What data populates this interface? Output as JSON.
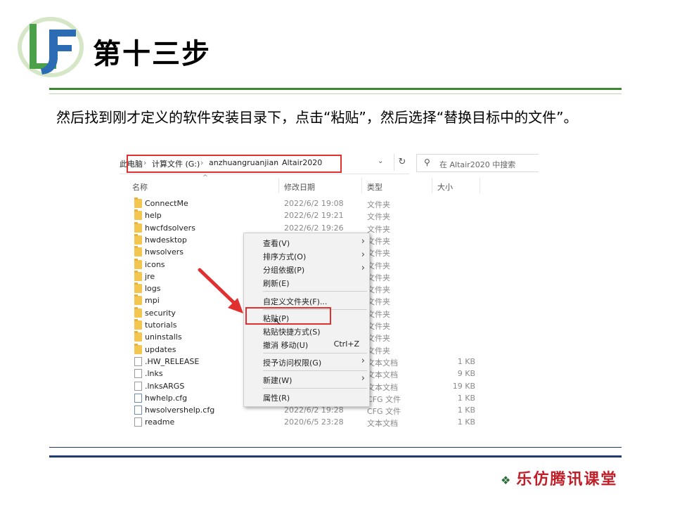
{
  "slide": {
    "title": "第十三步",
    "instruction": "然后找到刚才定义的软件安装目录下，点击“粘贴”，然后选择“替换目标中的文件”。",
    "footer": "乐仿腾讯课堂",
    "colors": {
      "green_rule": "#3a8a2e",
      "blue_rule": "#1f3b73",
      "highlight": "#e03030",
      "footer": "#c0202a"
    }
  },
  "explorer": {
    "breadcrumb": [
      "此电脑",
      "计算文件 (G:)",
      "anzhuangruanjian",
      "Altair2020"
    ],
    "search_placeholder": "在 Altair2020 中搜索",
    "columns": {
      "name": "名称",
      "date": "修改日期",
      "type": "类型",
      "size": "大小"
    },
    "rows": [
      {
        "name": "ConnectMe",
        "date": "2022/6/2 19:08",
        "type": "文件夹",
        "size": "",
        "icon": "folder-icon"
      },
      {
        "name": "help",
        "date": "2022/6/2 19:21",
        "type": "文件夹",
        "size": "",
        "icon": "folder-icon"
      },
      {
        "name": "hwcfdsolvers",
        "date": "2022/6/2 19:26",
        "type": "文件夹",
        "size": "",
        "icon": "folder-icon"
      },
      {
        "name": "hwdesktop",
        "date": "",
        "type": "文件夹",
        "size": "",
        "icon": "folder-icon"
      },
      {
        "name": "hwsolvers",
        "date": "",
        "type": "文件夹",
        "size": "",
        "icon": "folder-icon"
      },
      {
        "name": "icons",
        "date": "",
        "type": "文件夹",
        "size": "",
        "icon": "folder-icon"
      },
      {
        "name": "jre",
        "date": "",
        "type": "文件夹",
        "size": "",
        "icon": "folder-icon"
      },
      {
        "name": "logs",
        "date": "",
        "type": "文件夹",
        "size": "",
        "icon": "folder-icon"
      },
      {
        "name": "mpi",
        "date": "",
        "type": "文件夹",
        "size": "",
        "icon": "folder-icon"
      },
      {
        "name": "security",
        "date": "",
        "type": "文件夹",
        "size": "",
        "icon": "folder-icon"
      },
      {
        "name": "tutorials",
        "date": "",
        "type": "文件夹",
        "size": "",
        "icon": "folder-icon"
      },
      {
        "name": "uninstalls",
        "date": "",
        "type": "文件夹",
        "size": "",
        "icon": "folder-icon"
      },
      {
        "name": "updates",
        "date": "",
        "type": "文件夹",
        "size": "",
        "icon": "folder-icon"
      },
      {
        "name": ".HW_RELEASE",
        "date": "",
        "type": "文本文档",
        "size": "1 KB",
        "icon": "file-icon"
      },
      {
        "name": ".lnks",
        "date": "",
        "type": "文本文档",
        "size": "9 KB",
        "icon": "file-icon"
      },
      {
        "name": ".lnksARGS",
        "date": "",
        "type": "文本文档",
        "size": "19 KB",
        "icon": "file-icon"
      },
      {
        "name": "hwhelp.cfg",
        "date": "",
        "type": "CFG 文件",
        "size": "1 KB",
        "icon": "cfg-file-icon"
      },
      {
        "name": "hwsolvershelp.cfg",
        "date": "2022/6/2 19:28",
        "type": "CFG 文件",
        "size": "1 KB",
        "icon": "cfg-file-icon"
      },
      {
        "name": "readme",
        "date": "2020/6/5 23:28",
        "type": "文本文档",
        "size": "1 KB",
        "icon": "file-icon"
      }
    ]
  },
  "context_menu": {
    "items": [
      {
        "label": "查看(V)",
        "shortcut": "",
        "submenu": true
      },
      {
        "label": "排序方式(O)",
        "shortcut": "",
        "submenu": true
      },
      {
        "label": "分组依据(P)",
        "shortcut": "",
        "submenu": true
      },
      {
        "label": "刷新(E)",
        "shortcut": "",
        "submenu": false
      },
      {
        "label": "自定义文件夹(F)...",
        "shortcut": "",
        "submenu": false
      },
      {
        "label": "粘贴(P)",
        "shortcut": "",
        "submenu": false
      },
      {
        "label": "粘贴快捷方式(S)",
        "shortcut": "",
        "submenu": false
      },
      {
        "label": "撤消 移动(U)",
        "shortcut": "Ctrl+Z",
        "submenu": false
      },
      {
        "label": "授予访问权限(G)",
        "shortcut": "",
        "submenu": true
      },
      {
        "label": "新建(W)",
        "shortcut": "",
        "submenu": true
      },
      {
        "label": "属性(R)",
        "shortcut": "",
        "submenu": false
      }
    ]
  }
}
